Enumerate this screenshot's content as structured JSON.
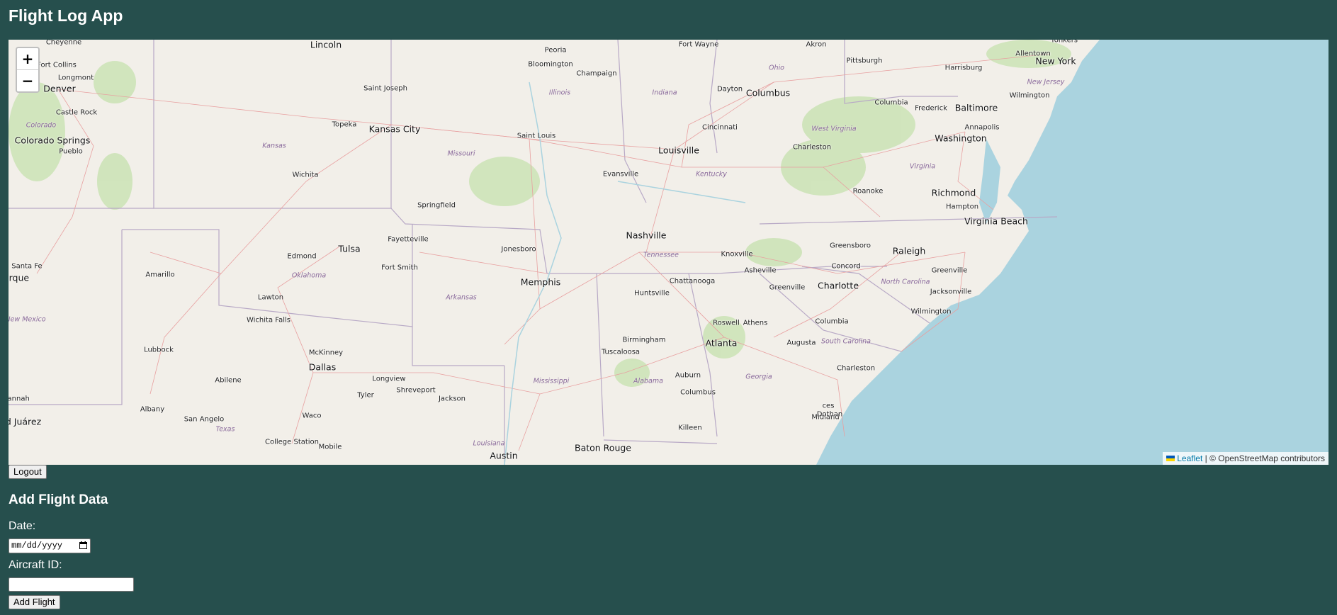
{
  "app": {
    "title": "Flight Log App"
  },
  "map": {
    "zoom_in": "+",
    "zoom_out": "−",
    "attribution": {
      "leaflet": "Leaflet",
      "separator": " | © OpenStreetMap contributors"
    },
    "colors": {
      "land": "#f2efe9",
      "water": "#aad3df",
      "road": "#e8a0a0",
      "border": "#b8a9c6",
      "forest": "#cde3b8"
    },
    "cities": [
      {
        "name": "Cheyenne",
        "big": false
      },
      {
        "name": "Lincoln",
        "big": true
      },
      {
        "name": "Peoria",
        "big": false
      },
      {
        "name": "Fort Wayne",
        "big": false
      },
      {
        "name": "Akron",
        "big": false
      },
      {
        "name": "Yonkers",
        "big": false
      },
      {
        "name": "Fort Collins",
        "big": false
      },
      {
        "name": "Bloomington",
        "big": false
      },
      {
        "name": "Pittsburgh",
        "big": false
      },
      {
        "name": "New York",
        "big": true
      },
      {
        "name": "Longmont",
        "big": false
      },
      {
        "name": "Champaign",
        "big": false
      },
      {
        "name": "Allentown",
        "big": false
      },
      {
        "name": "Harrisburg",
        "big": false
      },
      {
        "name": "Denver",
        "big": true
      },
      {
        "name": "Saint Joseph",
        "big": false
      },
      {
        "name": "Dayton",
        "big": false
      },
      {
        "name": "Columbus",
        "big": true
      },
      {
        "name": "Wilmington",
        "big": false
      },
      {
        "name": "Castle Rock",
        "big": false
      },
      {
        "name": "Frederick",
        "big": false
      },
      {
        "name": "Baltimore",
        "big": true
      },
      {
        "name": "Columbia",
        "big": false
      },
      {
        "name": "Topeka",
        "big": false
      },
      {
        "name": "Kansas City",
        "big": true
      },
      {
        "name": "Cincinnati",
        "big": false
      },
      {
        "name": "Annapolis",
        "big": false
      },
      {
        "name": "Saint Louis",
        "big": false
      },
      {
        "name": "Washington",
        "big": true
      },
      {
        "name": "Colorado Springs",
        "big": true
      },
      {
        "name": "Charleston",
        "big": false
      },
      {
        "name": "Pueblo",
        "big": false
      },
      {
        "name": "Louisville",
        "big": true
      },
      {
        "name": "Evansville",
        "big": false
      },
      {
        "name": "Wichita",
        "big": false
      },
      {
        "name": "Richmond",
        "big": true
      },
      {
        "name": "Roanoke",
        "big": false
      },
      {
        "name": "Springfield",
        "big": false
      },
      {
        "name": "Hampton",
        "big": false
      },
      {
        "name": "Virginia Beach",
        "big": true
      },
      {
        "name": "Nashville",
        "big": true
      },
      {
        "name": "Fayetteville",
        "big": false
      },
      {
        "name": "Tulsa",
        "big": true
      },
      {
        "name": "Greensboro",
        "big": false
      },
      {
        "name": "Raleigh",
        "big": true
      },
      {
        "name": "Jonesboro",
        "big": false
      },
      {
        "name": "Knoxville",
        "big": false
      },
      {
        "name": "Edmond",
        "big": false
      },
      {
        "name": "Santa Fe",
        "big": false
      },
      {
        "name": "Fort Smith",
        "big": false
      },
      {
        "name": "Concord",
        "big": false
      },
      {
        "name": "Greenville",
        "big": false
      },
      {
        "name": "Amarillo",
        "big": false
      },
      {
        "name": "Memphis",
        "big": true
      },
      {
        "name": "Asheville",
        "big": false
      },
      {
        "name": "erque",
        "big": true
      },
      {
        "name": "Chattanooga",
        "big": false
      },
      {
        "name": "Charlotte",
        "big": true
      },
      {
        "name": "Greenville",
        "big": false
      },
      {
        "name": "Huntsville",
        "big": false
      },
      {
        "name": "Jacksonville",
        "big": false
      },
      {
        "name": "Lawton",
        "big": false
      },
      {
        "name": "Wichita Falls",
        "big": false
      },
      {
        "name": "Wilmington",
        "big": false
      },
      {
        "name": "Roswell",
        "big": false
      },
      {
        "name": "Athens",
        "big": false
      },
      {
        "name": "Columbia",
        "big": false
      },
      {
        "name": "Birmingham",
        "big": false
      },
      {
        "name": "Atlanta",
        "big": true
      },
      {
        "name": "Augusta",
        "big": false
      },
      {
        "name": "Lubbock",
        "big": false
      },
      {
        "name": "McKinney",
        "big": false
      },
      {
        "name": "Tuscaloosa",
        "big": false
      },
      {
        "name": "Dallas",
        "big": true
      },
      {
        "name": "Charleston",
        "big": false
      },
      {
        "name": "Longview",
        "big": false
      },
      {
        "name": "Auburn",
        "big": false
      },
      {
        "name": "Abilene",
        "big": false
      },
      {
        "name": "Shreveport",
        "big": false
      },
      {
        "name": "Columbus",
        "big": false
      },
      {
        "name": "Tyler",
        "big": false
      },
      {
        "name": "Jackson",
        "big": false
      },
      {
        "name": "ces",
        "big": false
      },
      {
        "name": "Savannah",
        "big": false
      },
      {
        "name": "Midland",
        "big": false
      },
      {
        "name": "Albany",
        "big": false
      },
      {
        "name": "San Angelo",
        "big": false
      },
      {
        "name": "Waco",
        "big": false
      },
      {
        "name": "d Juárez",
        "big": true
      },
      {
        "name": "Dothan",
        "big": false
      },
      {
        "name": "Killeen",
        "big": false
      },
      {
        "name": "College Station",
        "big": false
      },
      {
        "name": "Mobile",
        "big": false
      },
      {
        "name": "Baton Rouge",
        "big": true
      },
      {
        "name": "Austin",
        "big": true
      }
    ],
    "states": [
      "Illinois",
      "Indiana",
      "Ohio",
      "New Jersey",
      "Colorado",
      "West Virginia",
      "Kansas",
      "Missouri",
      "Kentucky",
      "Virginia",
      "Tennessee",
      "Oklahoma",
      "North Carolina",
      "Arkansas",
      "New Mexico",
      "South Carolina",
      "Mississippi",
      "Alabama",
      "Georgia",
      "Texas",
      "Louisiana"
    ]
  },
  "auth": {
    "logout_label": "Logout"
  },
  "form": {
    "heading": "Add Flight Data",
    "date_label": "Date:",
    "date_placeholder": "mm/dd/yyyy",
    "aircraft_label": "Aircraft ID:",
    "aircraft_value": "",
    "submit_label": "Add Flight"
  }
}
